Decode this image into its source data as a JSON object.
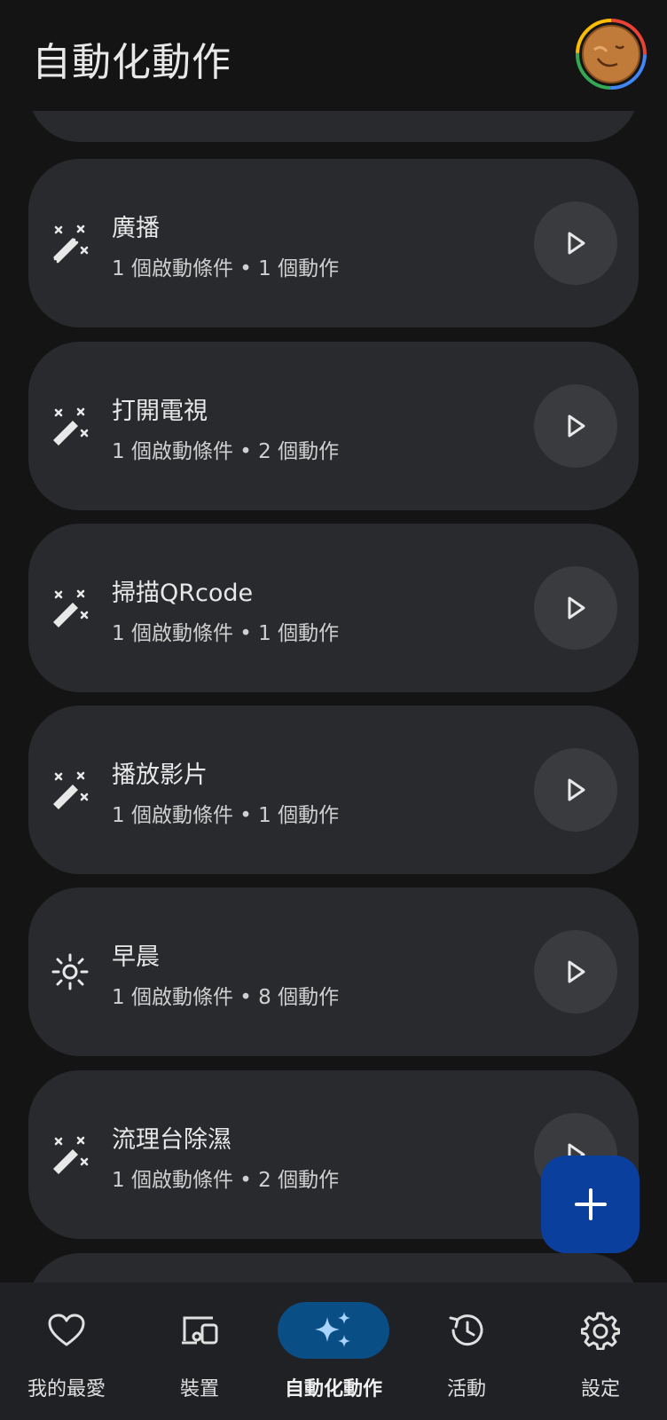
{
  "header": {
    "title": "自動化動作"
  },
  "automations": [
    {
      "name": "廣播",
      "subtitle": "1 個啟動條件 • 1 個動作",
      "icon": "magic-wand-icon"
    },
    {
      "name": "打開電視",
      "subtitle": "1 個啟動條件 • 2 個動作",
      "icon": "magic-wand-icon"
    },
    {
      "name": "掃描QRcode",
      "subtitle": "1 個啟動條件 • 1 個動作",
      "icon": "magic-wand-icon"
    },
    {
      "name": "播放影片",
      "subtitle": "1 個啟動條件 • 1 個動作",
      "icon": "magic-wand-icon"
    },
    {
      "name": "早晨",
      "subtitle": "1 個啟動條件 • 8 個動作",
      "icon": "sun-icon"
    },
    {
      "name": "流理台除濕",
      "subtitle": "1 個啟動條件 • 2 個動作",
      "icon": "magic-wand-icon"
    }
  ],
  "nav": {
    "items": [
      {
        "label": "我的最愛",
        "icon": "heart-icon"
      },
      {
        "label": "裝置",
        "icon": "devices-icon"
      },
      {
        "label": "自動化動作",
        "icon": "sparkle-icon",
        "active": true
      },
      {
        "label": "活動",
        "icon": "history-icon"
      },
      {
        "label": "設定",
        "icon": "gear-icon"
      }
    ]
  },
  "colors": {
    "background": "#141414",
    "card": "#292a2d",
    "fab": "#0b3f9e",
    "nav_active": "#0a4e86",
    "sparkle": "#a8d4ff"
  }
}
